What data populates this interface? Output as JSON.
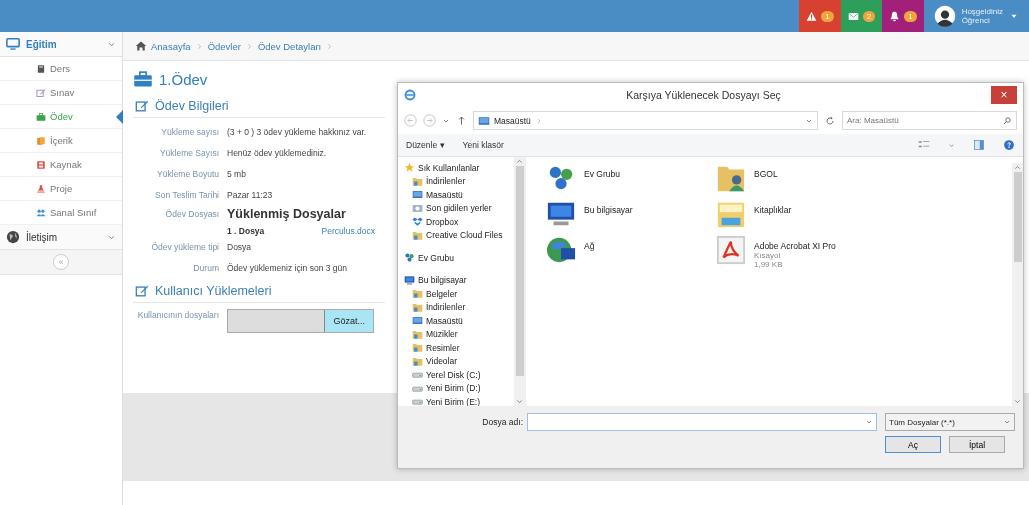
{
  "topbar": {
    "notifications": [
      {
        "kind": "alert",
        "count": "1",
        "color": "#d8412f"
      },
      {
        "kind": "message",
        "count": "2",
        "color": "#2e9e5b"
      },
      {
        "kind": "bell",
        "count": "1",
        "color": "#a21f7a"
      }
    ],
    "user": {
      "greeting": "Hoşgeldiniz",
      "name": "Öğrenci"
    }
  },
  "sidebar": {
    "groups": [
      {
        "label": "Eğitim",
        "expanded": true,
        "children": [
          {
            "label": "Ders",
            "kind": "book",
            "selected": false
          },
          {
            "label": "Sınav",
            "kind": "edit",
            "selected": false
          },
          {
            "label": "Ödev",
            "kind": "briefcase",
            "selected": true
          },
          {
            "label": "İçerik",
            "kind": "files",
            "selected": false
          },
          {
            "label": "Kaynak",
            "kind": "film",
            "selected": false
          },
          {
            "label": "Proje",
            "kind": "flask",
            "selected": false
          },
          {
            "label": "Sanal Sınıf",
            "kind": "users",
            "selected": false
          }
        ]
      },
      {
        "label": "İletişim",
        "expanded": false
      }
    ],
    "collapse": "«"
  },
  "breadcrumb": [
    "Anasayfa",
    "Ödevler",
    "Ödev Detayları"
  ],
  "page": {
    "title": "1.Ödev",
    "info_section": {
      "title": "Ödev Bilgileri",
      "rows": [
        {
          "kind": "text",
          "label": "Yükleme sayısı",
          "value": "(3 + 0 ) 3 ödev yükleme hakkınız var."
        },
        {
          "kind": "text",
          "label": "Yükleme Sayısı",
          "value": "Henüz ödev yüklemediniz."
        },
        {
          "kind": "text",
          "label": "Yükleme Boyutu",
          "value": "5 mb"
        },
        {
          "kind": "text",
          "label": "Son Teslim Tarihi",
          "value": "Pazar 11:23"
        },
        {
          "kind": "files",
          "label": "Ödev Dosyası",
          "heading": "Yüklenmiş Dosyalar",
          "files": [
            {
              "index": "1 . Dosya",
              "link": "Perculus.docx"
            }
          ]
        },
        {
          "kind": "text",
          "label": "Ödev yükleme tipi",
          "value": "Dosya"
        },
        {
          "kind": "text",
          "label": "Durum",
          "value": "Ödev yüklemeniz için son 3 gün"
        }
      ]
    },
    "upload_section": {
      "title": "Kullanıcı Yüklemeleri",
      "label": "Kullanıcının dosyaları",
      "browse_button": "Gözat..."
    }
  },
  "dialog": {
    "title": "Karşıya Yüklenecek Dosyayı Seç",
    "close": "×",
    "address": "Masaüstü",
    "search_placeholder": "Ara: Masaüstü",
    "toolbar": [
      "Düzenle ▾",
      "Yeni klasör"
    ],
    "tree": [
      {
        "label": "Sık Kullanılanlar",
        "kind": "star",
        "children": [
          {
            "label": "İndirilenler",
            "kind": "folder"
          },
          {
            "label": "Masaüstü",
            "kind": "desktop"
          },
          {
            "label": "Son gidilen yerler",
            "kind": "recent"
          },
          {
            "label": "Dropbox",
            "kind": "dropbox"
          },
          {
            "label": "Creative Cloud Files",
            "kind": "folder"
          }
        ]
      },
      {
        "label": "Ev Grubu",
        "kind": "homegroup"
      },
      {
        "label": "Bu bilgisayar",
        "kind": "computer",
        "children": [
          {
            "label": "Belgeler",
            "kind": "folder"
          },
          {
            "label": "İndirilenler",
            "kind": "folder"
          },
          {
            "label": "Masaüstü",
            "kind": "desktop"
          },
          {
            "label": "Müzikler",
            "kind": "folder"
          },
          {
            "label": "Resimler",
            "kind": "folder"
          },
          {
            "label": "Videolar",
            "kind": "folder"
          },
          {
            "label": "Yerel Disk (C:)",
            "kind": "drive"
          },
          {
            "label": "Yeni Birim (D:)",
            "kind": "drive"
          },
          {
            "label": "Yeni Birim (E:)",
            "kind": "drive"
          }
        ]
      }
    ],
    "items": [
      {
        "name": "Ev Grubu",
        "kind": "homegroup"
      },
      {
        "name": "BGOL",
        "kind": "userfolder"
      },
      {
        "name": "Bu bilgisayar",
        "kind": "computer"
      },
      {
        "name": "Kitaplıklar",
        "kind": "library"
      },
      {
        "name": "Ağ",
        "kind": "network"
      },
      {
        "name": "Adobe Acrobat XI Pro",
        "kind": "pdf",
        "details": [
          "Kısayol",
          "1,99 KB"
        ]
      }
    ],
    "filename_label": "Dosya adı:",
    "filter": "Tüm Dosyalar (*.*)",
    "open_button": "Aç",
    "cancel_button": "İptal"
  }
}
